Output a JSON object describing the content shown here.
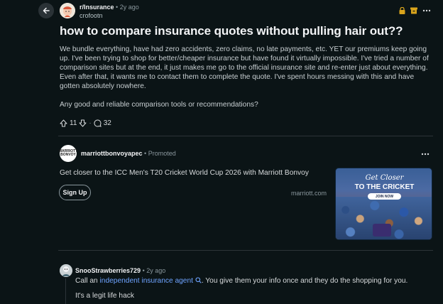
{
  "post": {
    "subreddit": "r/Insurance",
    "separator": "•",
    "age": "2y ago",
    "author": "crofootn",
    "title": "how to compare insurance quotes without pulling hair out??",
    "body": "We bundle everything, have had zero accidents, zero claims, no late payments, etc. YET our premiums keep going up. I've been trying to shop for better/cheaper insurance but have found it virtually impossible. I've tried a number of comparison sites but at the end, it just makes me go to the official insurance site and re-enter just about everything. Even after that, it wants me to contact them to complete the quote. I've spent hours messing with this and have gotten absolutely nowhere.",
    "question": "Any good and reliable comparison tools or recommendations?",
    "upvotes": "11",
    "dot": "·",
    "comments": "32"
  },
  "icons": {
    "back": "back-arrow-icon",
    "locked": "lock-icon",
    "archived": "archive-icon",
    "more": "more-icon",
    "upvote": "upvote-icon",
    "downvote": "downvote-icon",
    "comment": "comment-icon",
    "search": "search-icon"
  },
  "ad": {
    "advertiser": "marriottbonvoyapec",
    "promoted": "• Promoted",
    "logo_text": "MARRIOTT BONVOY",
    "headline": "Get closer to the ICC Men's T20 Cricket World Cup 2026 with Marriott Bonvoy",
    "cta": "Sign Up",
    "domain": "marriott.com",
    "image": {
      "line1": "Get Closer",
      "line2": "TO THE CRICKET",
      "button": "JOIN NOW"
    }
  },
  "comment": {
    "author": "SnooStrawberries729",
    "age": "• 2y ago",
    "text_before": "Call an ",
    "link": "independent insurance agent",
    "text_after": ". You give them your info once and they do the shopping for you.",
    "text2": "It's a legit life hack"
  },
  "colors": {
    "background": "#0b1416",
    "accent_icon": "#d9a41c",
    "link": "#6ea3ff"
  }
}
